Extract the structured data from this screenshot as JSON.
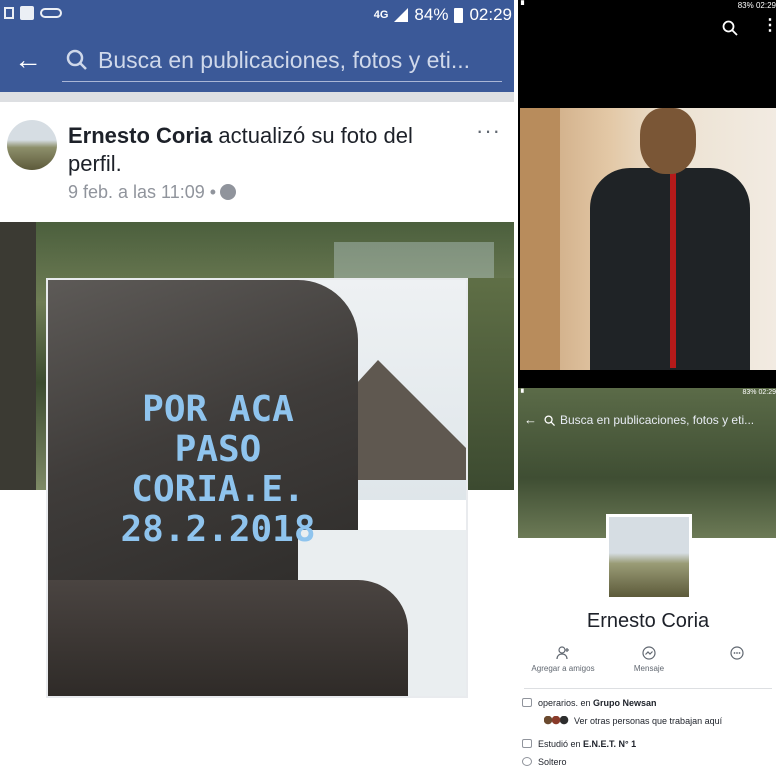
{
  "left": {
    "status": {
      "battery": "84%",
      "time": "02:29",
      "network": "4G"
    },
    "search": {
      "placeholder": "Busca en publicaciones, fotos y eti..."
    },
    "post": {
      "author": "Ernesto Coria",
      "action": " actualizó su foto del perfil.",
      "timestamp": "9 feb. a las 11:09",
      "separator": "•"
    },
    "photo": {
      "graffiti_lines": [
        "POR ACA",
        "PASO",
        "CORIA.E.",
        "28.2.2018"
      ]
    }
  },
  "right": {
    "status": {
      "time": "02:29",
      "battery": "83%"
    },
    "profile": {
      "search_placeholder": "Busca en publicaciones, fotos y eti...",
      "name": "Ernesto Coria",
      "actions": [
        "Agregar a amigos",
        "Mensaje",
        ""
      ],
      "work_prefix": "operarios. en ",
      "work_place": "Grupo Newsan",
      "coworkers": "Ver otras personas que trabajan aquí",
      "study_prefix": "Estudió en ",
      "study_place": "E.N.E.T. N° 1",
      "relationship": "Soltero"
    }
  },
  "colors": {
    "facebook_blue": "#3b5998",
    "graffiti": "#8fc4ee"
  }
}
